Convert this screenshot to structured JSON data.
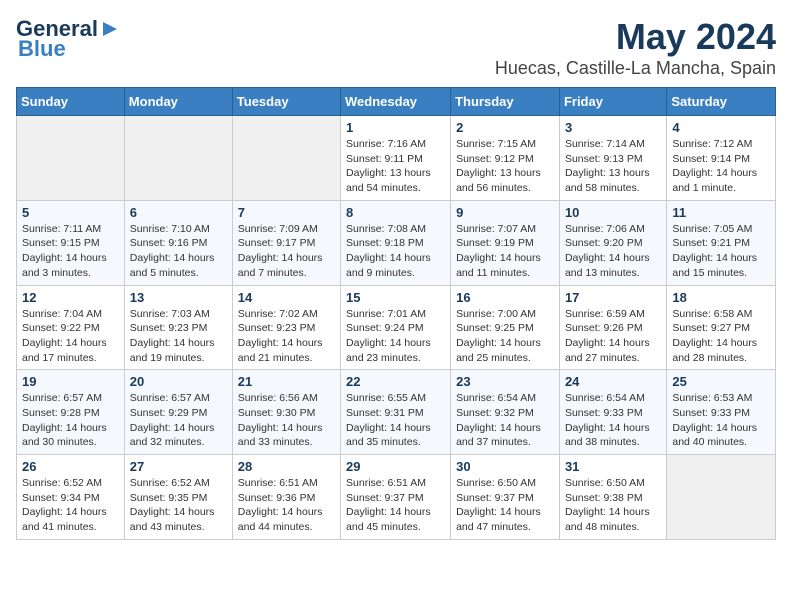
{
  "header": {
    "logo_general": "General",
    "logo_blue": "Blue",
    "title": "May 2024",
    "subtitle": "Huecas, Castille-La Mancha, Spain"
  },
  "weekdays": [
    "Sunday",
    "Monday",
    "Tuesday",
    "Wednesday",
    "Thursday",
    "Friday",
    "Saturday"
  ],
  "weeks": [
    [
      {
        "day": "",
        "info": ""
      },
      {
        "day": "",
        "info": ""
      },
      {
        "day": "",
        "info": ""
      },
      {
        "day": "1",
        "info": "Sunrise: 7:16 AM\nSunset: 9:11 PM\nDaylight: 13 hours and 54 minutes."
      },
      {
        "day": "2",
        "info": "Sunrise: 7:15 AM\nSunset: 9:12 PM\nDaylight: 13 hours and 56 minutes."
      },
      {
        "day": "3",
        "info": "Sunrise: 7:14 AM\nSunset: 9:13 PM\nDaylight: 13 hours and 58 minutes."
      },
      {
        "day": "4",
        "info": "Sunrise: 7:12 AM\nSunset: 9:14 PM\nDaylight: 14 hours and 1 minute."
      }
    ],
    [
      {
        "day": "5",
        "info": "Sunrise: 7:11 AM\nSunset: 9:15 PM\nDaylight: 14 hours and 3 minutes."
      },
      {
        "day": "6",
        "info": "Sunrise: 7:10 AM\nSunset: 9:16 PM\nDaylight: 14 hours and 5 minutes."
      },
      {
        "day": "7",
        "info": "Sunrise: 7:09 AM\nSunset: 9:17 PM\nDaylight: 14 hours and 7 minutes."
      },
      {
        "day": "8",
        "info": "Sunrise: 7:08 AM\nSunset: 9:18 PM\nDaylight: 14 hours and 9 minutes."
      },
      {
        "day": "9",
        "info": "Sunrise: 7:07 AM\nSunset: 9:19 PM\nDaylight: 14 hours and 11 minutes."
      },
      {
        "day": "10",
        "info": "Sunrise: 7:06 AM\nSunset: 9:20 PM\nDaylight: 14 hours and 13 minutes."
      },
      {
        "day": "11",
        "info": "Sunrise: 7:05 AM\nSunset: 9:21 PM\nDaylight: 14 hours and 15 minutes."
      }
    ],
    [
      {
        "day": "12",
        "info": "Sunrise: 7:04 AM\nSunset: 9:22 PM\nDaylight: 14 hours and 17 minutes."
      },
      {
        "day": "13",
        "info": "Sunrise: 7:03 AM\nSunset: 9:23 PM\nDaylight: 14 hours and 19 minutes."
      },
      {
        "day": "14",
        "info": "Sunrise: 7:02 AM\nSunset: 9:23 PM\nDaylight: 14 hours and 21 minutes."
      },
      {
        "day": "15",
        "info": "Sunrise: 7:01 AM\nSunset: 9:24 PM\nDaylight: 14 hours and 23 minutes."
      },
      {
        "day": "16",
        "info": "Sunrise: 7:00 AM\nSunset: 9:25 PM\nDaylight: 14 hours and 25 minutes."
      },
      {
        "day": "17",
        "info": "Sunrise: 6:59 AM\nSunset: 9:26 PM\nDaylight: 14 hours and 27 minutes."
      },
      {
        "day": "18",
        "info": "Sunrise: 6:58 AM\nSunset: 9:27 PM\nDaylight: 14 hours and 28 minutes."
      }
    ],
    [
      {
        "day": "19",
        "info": "Sunrise: 6:57 AM\nSunset: 9:28 PM\nDaylight: 14 hours and 30 minutes."
      },
      {
        "day": "20",
        "info": "Sunrise: 6:57 AM\nSunset: 9:29 PM\nDaylight: 14 hours and 32 minutes."
      },
      {
        "day": "21",
        "info": "Sunrise: 6:56 AM\nSunset: 9:30 PM\nDaylight: 14 hours and 33 minutes."
      },
      {
        "day": "22",
        "info": "Sunrise: 6:55 AM\nSunset: 9:31 PM\nDaylight: 14 hours and 35 minutes."
      },
      {
        "day": "23",
        "info": "Sunrise: 6:54 AM\nSunset: 9:32 PM\nDaylight: 14 hours and 37 minutes."
      },
      {
        "day": "24",
        "info": "Sunrise: 6:54 AM\nSunset: 9:33 PM\nDaylight: 14 hours and 38 minutes."
      },
      {
        "day": "25",
        "info": "Sunrise: 6:53 AM\nSunset: 9:33 PM\nDaylight: 14 hours and 40 minutes."
      }
    ],
    [
      {
        "day": "26",
        "info": "Sunrise: 6:52 AM\nSunset: 9:34 PM\nDaylight: 14 hours and 41 minutes."
      },
      {
        "day": "27",
        "info": "Sunrise: 6:52 AM\nSunset: 9:35 PM\nDaylight: 14 hours and 43 minutes."
      },
      {
        "day": "28",
        "info": "Sunrise: 6:51 AM\nSunset: 9:36 PM\nDaylight: 14 hours and 44 minutes."
      },
      {
        "day": "29",
        "info": "Sunrise: 6:51 AM\nSunset: 9:37 PM\nDaylight: 14 hours and 45 minutes."
      },
      {
        "day": "30",
        "info": "Sunrise: 6:50 AM\nSunset: 9:37 PM\nDaylight: 14 hours and 47 minutes."
      },
      {
        "day": "31",
        "info": "Sunrise: 6:50 AM\nSunset: 9:38 PM\nDaylight: 14 hours and 48 minutes."
      },
      {
        "day": "",
        "info": ""
      }
    ]
  ]
}
